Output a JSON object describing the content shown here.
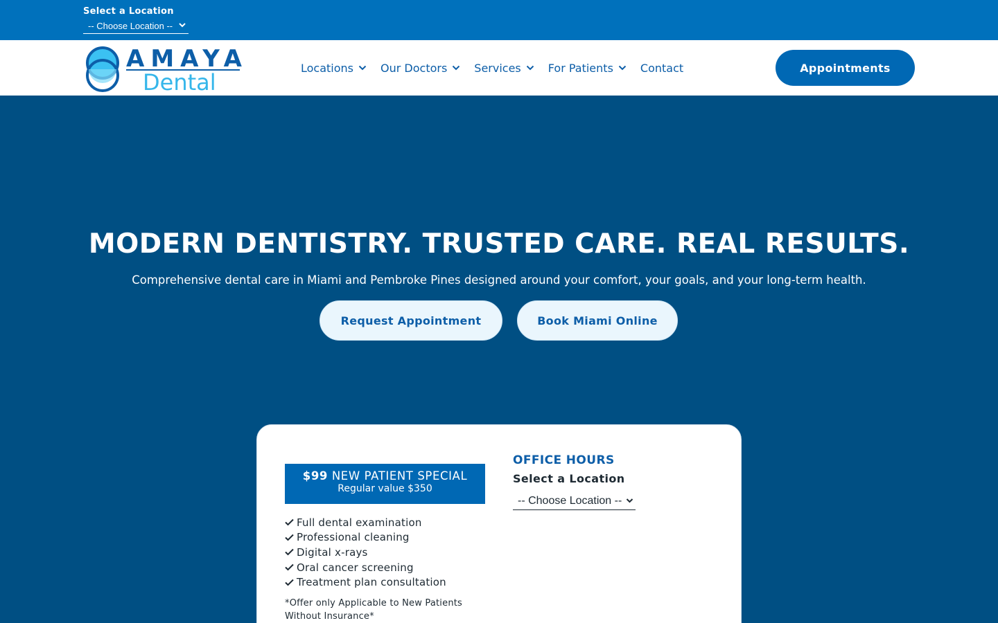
{
  "topbar": {
    "location_label": "Select a Location",
    "location_select_value": "-- Choose Location --"
  },
  "header": {
    "logo": {
      "line1": "AMAYA",
      "line2": "Dental"
    },
    "nav": [
      {
        "label": "Locations",
        "has_dropdown": true
      },
      {
        "label": "Our Doctors",
        "has_dropdown": true
      },
      {
        "label": "Services",
        "has_dropdown": true
      },
      {
        "label": "For Patients",
        "has_dropdown": true
      },
      {
        "label": "Contact",
        "has_dropdown": false
      }
    ],
    "cta_label": "Appointments"
  },
  "hero": {
    "title": "MODERN DENTISTRY. TRUSTED CARE. REAL RESULTS.",
    "subtitle": "Comprehensive dental care in Miami and Pembroke Pines designed around your comfort, your goals, and your long-term health.",
    "buttons": {
      "request": "Request Appointment",
      "book": "Book Miami Online"
    }
  },
  "special": {
    "price": "$99",
    "title": "NEW PATIENT SPECIAL",
    "regular_value": "Regular value $350",
    "items": [
      "Full dental examination",
      "Professional cleaning",
      "Digital x-rays",
      "Oral cancer screening",
      "Treatment plan consultation"
    ],
    "disclaimer": "*Offer only Applicable to New Patients Without Insurance*"
  },
  "office_hours": {
    "title": "OFFICE HOURS",
    "select_label": "Select a Location",
    "select_value": "-- Choose Location --"
  },
  "colors": {
    "topbar": "#0071bc",
    "hero_bg": "#004f83",
    "brand_blue": "#0d5ea8",
    "button_blue": "#0068b4",
    "accent_light": "#35b6ea"
  },
  "icons": {
    "dropdown": "chevron-down-icon",
    "check": "check-icon",
    "logo": "tooth-rings-logo-icon"
  }
}
